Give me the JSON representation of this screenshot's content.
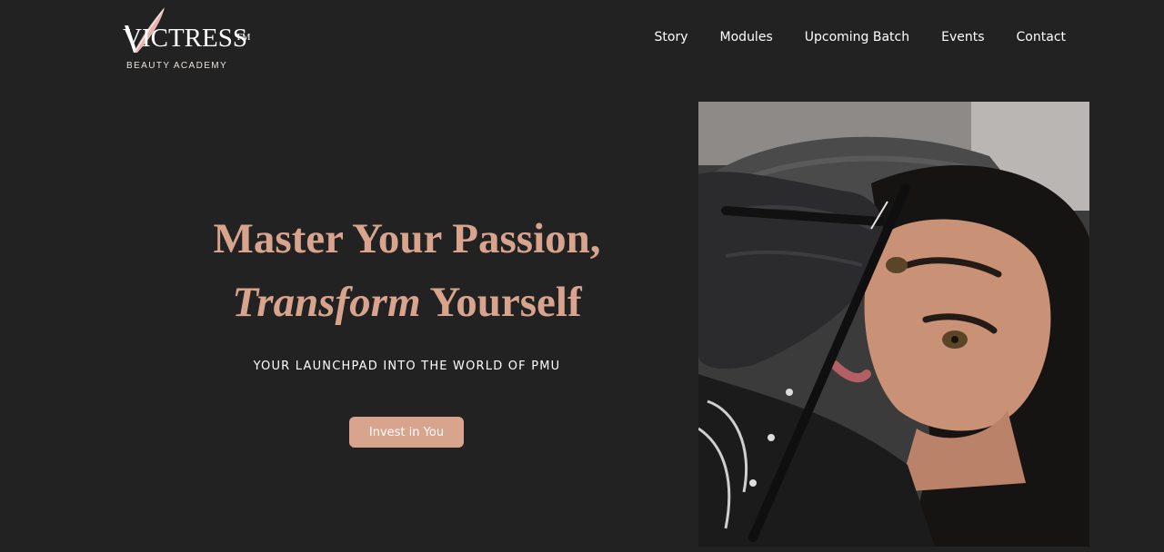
{
  "brand": {
    "name": "VICTRESS",
    "trademark": "TM",
    "tagline": "BEAUTY ACADEMY"
  },
  "nav": {
    "items": [
      {
        "label": "Story"
      },
      {
        "label": "Modules"
      },
      {
        "label": "Upcoming Batch"
      },
      {
        "label": "Events"
      },
      {
        "label": "Contact"
      }
    ]
  },
  "hero": {
    "title_line1": "Master Your Passion,",
    "title_line2_italic": "Transform",
    "title_line2_rest": " Yourself",
    "subtitle": "YOUR LAUNCHPAD INTO THE WORLD OF PMU",
    "cta_label": "Invest in You"
  },
  "photo": {
    "icon": "pmu-procedure-photo"
  },
  "colors": {
    "background": "#232222",
    "accent": "#d9a48e",
    "text": "#ffffff"
  }
}
